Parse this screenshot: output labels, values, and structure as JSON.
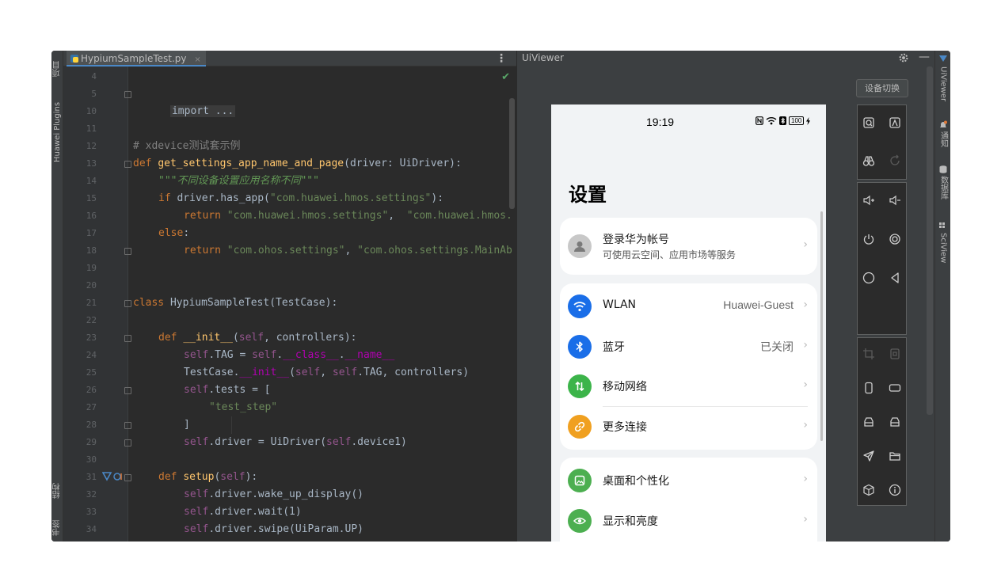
{
  "left_strip": {
    "tab_project": "项目",
    "tab_plugins": "Huawei Plugins",
    "tab_structure": "结构",
    "tab_bookmarks": "书签"
  },
  "editor": {
    "file_tab": "HypiumSampleTest.py",
    "file_tab_close": "×",
    "menu_glyph": "⋮",
    "inspection_ok": "✔",
    "line_numbers": [
      "4",
      "5",
      "10",
      "11",
      "12",
      "13",
      "14",
      "15",
      "16",
      "17",
      "18",
      "19",
      "20",
      "21",
      "22",
      "23",
      "24",
      "25",
      "26",
      "27",
      "28",
      "29",
      "30",
      "31",
      "32",
      "33",
      "34"
    ],
    "code": {
      "l5_import": "import ...",
      "l12_comment": "# xdevice测试套示例",
      "l13_def": "def ",
      "l13_fn": "get_settings_app_name_and_page",
      "l13_rest": "(driver: UiDriver):",
      "l14_doc": "\"\"\"不同设备设置应用名称不同\"\"\"",
      "l15_if": "if ",
      "l15_mid": "driver.has_app(",
      "l15_str": "\"com.huawei.hmos.settings\"",
      "l15_end": "):",
      "l16_return": "return ",
      "l16_str1": "\"com.huawei.hmos.settings\"",
      "l16_comma": ",  ",
      "l16_str2": "\"com.huawei.hmos.",
      "l17_else": "else",
      "l17_colon": ":",
      "l18_return": "return ",
      "l18_str1": "\"com.ohos.settings\"",
      "l18_comma": ", ",
      "l18_str2": "\"com.ohos.settings.MainAb",
      "l21_class": "class ",
      "l21_rest": "HypiumSampleTest(TestCase):",
      "l23_def": "def ",
      "l23_fn": "__init__",
      "l23_open": "(",
      "l23_self": "self",
      "l23_rest": ", controllers):",
      "l24_self": "self",
      "l24_a": ".TAG = ",
      "l24_self2": "self",
      "l24_b": ".",
      "l24_c": "__class__",
      "l24_d": ".",
      "l24_e": "__name__",
      "l25_a": "TestCase.",
      "l25_b": "__init__",
      "l25_c": "(",
      "l25_self": "self",
      "l25_d": ", ",
      "l25_self2": "self",
      "l25_e": ".TAG, controllers)",
      "l26_self": "self",
      "l26_rest": ".tests = [",
      "l27_str": "\"test_step\"",
      "l28_close": "]",
      "l29_self": "self",
      "l29_a": ".driver = UiDriver(",
      "l29_self2": "self",
      "l29_b": ".device1)",
      "l31_def": "def ",
      "l31_fn": "setup",
      "l31_open": "(",
      "l31_self": "self",
      "l31_close": "):",
      "l32_self": "self",
      "l32_rest": ".driver.wake_up_display()",
      "l33_self": "self",
      "l33_rest": ".driver.wait(1)",
      "l34_self": "self",
      "l34_rest": ".driver.swipe(UiParam.UP)"
    }
  },
  "uiviewer": {
    "title": "UiViewer",
    "gear_icon": "gear-icon",
    "minimize_glyph": "—",
    "switch_device_button": "设备切换",
    "tools": [
      "search-screen-icon",
      "hierarchy-icon",
      "binoculars-icon",
      "refresh-icon",
      "volume-up-icon",
      "volume-down-icon",
      "power-icon",
      "screenshot-icon",
      "home-icon",
      "back-icon",
      "crop-icon",
      "copy-icon",
      "portrait-icon",
      "landscape-icon",
      "device-left-icon",
      "device-right-icon",
      "send-icon",
      "folder-icon",
      "cube-icon",
      "info-icon"
    ]
  },
  "phone": {
    "time": "19:19",
    "battery": "100",
    "status_icons": [
      "nfc-icon",
      "wifi-icon",
      "bluetooth-status-icon",
      "battery-icon",
      "charging-icon"
    ],
    "title": "设置",
    "account": {
      "label": "登录华为帐号",
      "sub": "可使用云空间、应用市场等服务"
    },
    "rows": [
      {
        "label": "WLAN",
        "value": "Huawei-Guest",
        "icon": "wifi-icon",
        "color": "#1a6ee8"
      },
      {
        "label": "蓝牙",
        "value": "已关闭",
        "icon": "bluetooth-icon",
        "color": "#1a6ee8"
      },
      {
        "label": "移动网络",
        "value": "",
        "icon": "mobile-data-icon",
        "color": "#3cb44a"
      },
      {
        "label": "更多连接",
        "value": "",
        "icon": "link-icon",
        "color": "#f0a020"
      },
      {
        "label": "桌面和个性化",
        "value": "",
        "icon": "wallpaper-icon",
        "color": "#4caf50"
      },
      {
        "label": "显示和亮度",
        "value": "",
        "icon": "eye-icon",
        "color": "#4caf50"
      }
    ],
    "chevron": "›"
  },
  "right_strip": {
    "tab_uiviewer": "UiViewer",
    "tab_notify": "通知",
    "tab_database": "数据库",
    "tab_sciview": "SciView"
  },
  "colors": {
    "ide_bg": "#2b2b2b",
    "panel_bg": "#3c3f41",
    "keyword": "#cc7832",
    "function": "#ffc66d",
    "string": "#6a8759",
    "self": "#94558d",
    "accent_blue": "#1a6ee8"
  }
}
